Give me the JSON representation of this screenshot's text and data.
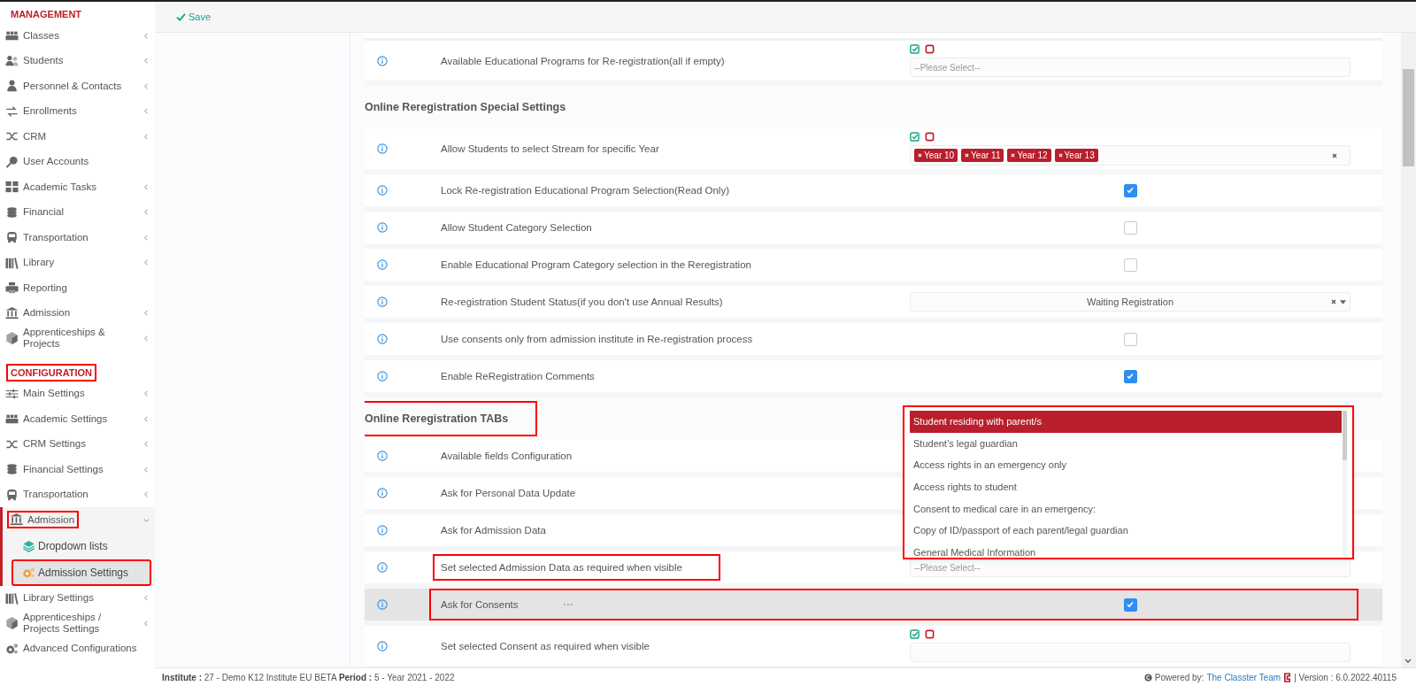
{
  "toolbar": {
    "save_label": "Save"
  },
  "sidebar": {
    "sections": [
      {
        "title": "MANAGEMENT",
        "framed": false,
        "items": [
          {
            "label": "Classes",
            "selected": false,
            "submenu": true,
            "expanded": false,
            "framed": false
          },
          {
            "label": "Students",
            "selected": false,
            "submenu": true,
            "expanded": false,
            "framed": false
          },
          {
            "label": "Personnel & Contacts",
            "selected": false,
            "submenu": true,
            "expanded": false,
            "framed": false
          },
          {
            "label": "Enrollments",
            "selected": false,
            "submenu": true,
            "expanded": false,
            "framed": false
          },
          {
            "label": "CRM",
            "selected": false,
            "submenu": true,
            "expanded": false,
            "framed": false
          },
          {
            "label": "User Accounts",
            "selected": false,
            "submenu": false,
            "expanded": false,
            "framed": false
          },
          {
            "label": "Academic Tasks",
            "selected": false,
            "submenu": true,
            "expanded": false,
            "framed": false
          },
          {
            "label": "Financial",
            "selected": false,
            "submenu": true,
            "expanded": false,
            "framed": false
          },
          {
            "label": "Transportation",
            "selected": false,
            "submenu": true,
            "expanded": false,
            "framed": false
          },
          {
            "label": "Library",
            "selected": false,
            "submenu": true,
            "expanded": false,
            "framed": false
          },
          {
            "label": "Reporting",
            "selected": false,
            "submenu": false,
            "expanded": false,
            "framed": false
          },
          {
            "label": "Admission",
            "selected": false,
            "submenu": true,
            "expanded": false,
            "framed": false
          },
          {
            "label": "Apprenticeships & Projects",
            "selected": false,
            "submenu": true,
            "expanded": false,
            "framed": false
          }
        ]
      },
      {
        "title": "CONFIGURATION",
        "framed": true,
        "items": [
          {
            "label": "Main Settings",
            "selected": false,
            "submenu": true,
            "expanded": false,
            "framed": false
          },
          {
            "label": "Academic Settings",
            "selected": false,
            "submenu": true,
            "expanded": false,
            "framed": false
          },
          {
            "label": "CRM Settings",
            "selected": false,
            "submenu": true,
            "expanded": false,
            "framed": false
          },
          {
            "label": "Financial Settings",
            "selected": false,
            "submenu": true,
            "expanded": false,
            "framed": false
          },
          {
            "label": "Transportation",
            "selected": false,
            "submenu": true,
            "expanded": false,
            "framed": false
          },
          {
            "label": "Admission",
            "selected": false,
            "submenu": true,
            "expanded": true,
            "framed": true,
            "children": [
              {
                "label": "Dropdown lists",
                "selected": false,
                "framed": false
              },
              {
                "label": "Admission Settings",
                "selected": true,
                "framed": true
              }
            ]
          },
          {
            "label": "Library Settings",
            "selected": false,
            "submenu": true,
            "expanded": false,
            "framed": false
          },
          {
            "label": "Apprenticeships / Projects Settings",
            "selected": false,
            "submenu": true,
            "expanded": false,
            "framed": false
          },
          {
            "label": "Advanced Configurations",
            "selected": false,
            "submenu": false,
            "expanded": false,
            "framed": false
          }
        ]
      }
    ]
  },
  "settings": [
    {
      "rows": [
        {
          "label": "Available Educational Programs for Re-registration(all if empty)",
          "kind": "select",
          "placeholder": "--Please Select--",
          "highlighted": false
        }
      ]
    },
    {
      "heading": "Online Reregistration Special Settings",
      "framed": false,
      "rows": [
        {
          "label": "Allow Students to select Stream for specific Year",
          "kind": "tags",
          "tags": [
            "Year 10",
            "Year 11",
            "Year 12",
            "Year 13"
          ],
          "highlighted": false
        },
        {
          "label": "Lock Re-registration Educational Program Selection(Read Only)",
          "kind": "checkbox",
          "checked": true,
          "highlighted": false
        },
        {
          "label": "Allow Student Category Selection",
          "kind": "checkbox",
          "checked": false,
          "highlighted": false
        },
        {
          "label": "Enable Educational Program Category selection in the Reregistration",
          "kind": "checkbox",
          "checked": false,
          "highlighted": false
        },
        {
          "label": "Re-registration Student Status(if you don't use Annual Results)",
          "kind": "dropdown",
          "value": "Waiting Registration",
          "highlighted": false
        },
        {
          "label": "Use consents only from admission institute in Re-registration process",
          "kind": "checkbox",
          "checked": false,
          "highlighted": false
        },
        {
          "label": "Enable ReRegistration Comments",
          "kind": "checkbox",
          "checked": true,
          "highlighted": false
        }
      ]
    },
    {
      "heading": "Online Reregistration TABs",
      "framed": true,
      "rows": [
        {
          "label": "Available fields Configuration",
          "highlighted": false
        },
        {
          "label": "Ask for Personal Data Update",
          "highlighted": false
        },
        {
          "label": "Ask for Admission Data",
          "highlighted": false
        },
        {
          "label": "Set selected Admission Data as required when visible",
          "kind": "open-select",
          "placeholder": "--Please Select--",
          "label_framed": true,
          "highlighted": false,
          "options": [
            {
              "label": "Student residing with parent/s",
              "selected": true
            },
            {
              "label": "Student’s legal guardian",
              "selected": false
            },
            {
              "label": "Access rights in an emergency only",
              "selected": false
            },
            {
              "label": "Access rights to student",
              "selected": false
            },
            {
              "label": "Consent to medical care in an emergency:",
              "selected": false
            },
            {
              "label": "Copy of ID/passport of each parent/legal guardian",
              "selected": false
            },
            {
              "label": "General Medical Information",
              "selected": false
            }
          ]
        },
        {
          "label": "Ask for Consents",
          "kind": "checkbox",
          "checked": true,
          "row_framed": true,
          "highlighted": true
        },
        {
          "label": "Set selected Consent as required when visible",
          "kind": "select",
          "highlighted": false
        }
      ]
    }
  ],
  "footer": {
    "info": "**Institute :** 27 - Demo K12 Institute EU BETA **Period :** 5 - Year 2021 - 2022",
    "powered_by": "Powered by:",
    "team_link": "The Classter Team",
    "version": "| Version : 6.0.2022.40115"
  }
}
